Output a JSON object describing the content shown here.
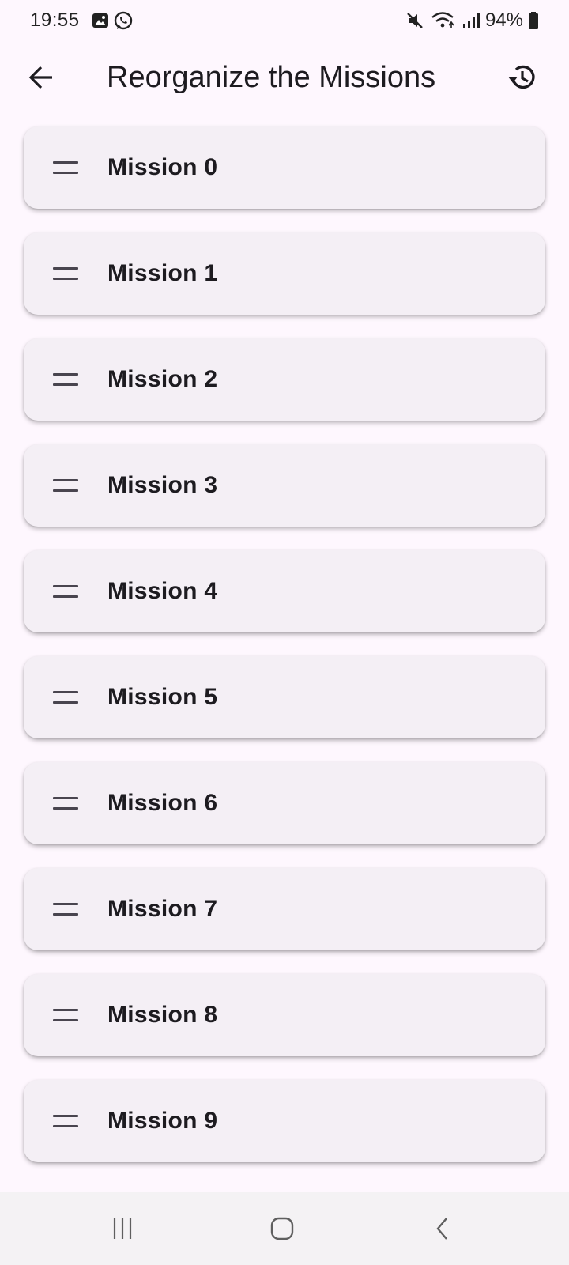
{
  "status_bar": {
    "time": "19:55",
    "battery": "94%",
    "icons": [
      "gallery-icon",
      "whatsapp-icon",
      "mute-icon",
      "wifi-icon",
      "signal-icon",
      "battery-icon"
    ]
  },
  "app_bar": {
    "title": "Reorganize the Missions",
    "back_icon": "arrow-back-icon",
    "history_icon": "history-icon"
  },
  "missions": [
    {
      "label": "Mission 0"
    },
    {
      "label": "Mission 1"
    },
    {
      "label": "Mission 2"
    },
    {
      "label": "Mission 3"
    },
    {
      "label": "Mission 4"
    },
    {
      "label": "Mission 5"
    },
    {
      "label": "Mission 6"
    },
    {
      "label": "Mission 7"
    },
    {
      "label": "Mission 8"
    },
    {
      "label": "Mission 9"
    }
  ],
  "nav_bar": {
    "icons": [
      "recents-icon",
      "home-icon",
      "back-icon"
    ]
  },
  "colors": {
    "background": "#fef7fe",
    "card": "#f4eff5",
    "text": "#1d1b20",
    "handle": "#49454f",
    "nav_bar": "#f4f2f4"
  }
}
